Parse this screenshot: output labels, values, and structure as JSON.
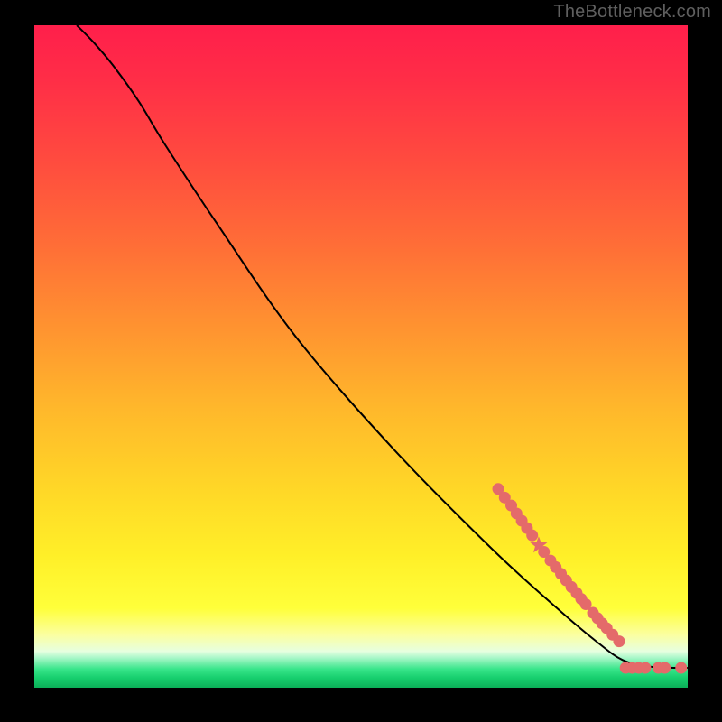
{
  "watermark": "TheBottleneck.com",
  "chart_data": {
    "type": "line",
    "title": "",
    "xlabel": "",
    "ylabel": "",
    "xlim": [
      0,
      100
    ],
    "ylim": [
      0,
      100
    ],
    "grid": false,
    "curve": [
      {
        "x": 6.5,
        "y": 100.0
      },
      {
        "x": 9.0,
        "y": 97.5
      },
      {
        "x": 12.0,
        "y": 94.0
      },
      {
        "x": 16.0,
        "y": 88.5
      },
      {
        "x": 20.0,
        "y": 82.0
      },
      {
        "x": 28.0,
        "y": 70.0
      },
      {
        "x": 40.0,
        "y": 53.0
      },
      {
        "x": 55.0,
        "y": 36.0
      },
      {
        "x": 70.0,
        "y": 21.0
      },
      {
        "x": 80.0,
        "y": 12.0
      },
      {
        "x": 86.0,
        "y": 7.0
      },
      {
        "x": 90.0,
        "y": 4.2
      },
      {
        "x": 94.0,
        "y": 3.2
      },
      {
        "x": 98.0,
        "y": 3.0
      },
      {
        "x": 100.0,
        "y": 3.0
      }
    ],
    "scatter": [
      {
        "x": 71.0,
        "y": 30.0
      },
      {
        "x": 72.0,
        "y": 28.7
      },
      {
        "x": 73.0,
        "y": 27.5
      },
      {
        "x": 73.8,
        "y": 26.3
      },
      {
        "x": 74.6,
        "y": 25.2
      },
      {
        "x": 75.4,
        "y": 24.1
      },
      {
        "x": 76.2,
        "y": 23.0
      },
      {
        "x": 78.0,
        "y": 20.5
      },
      {
        "x": 79.0,
        "y": 19.2
      },
      {
        "x": 79.8,
        "y": 18.2
      },
      {
        "x": 80.6,
        "y": 17.2
      },
      {
        "x": 81.4,
        "y": 16.2
      },
      {
        "x": 82.2,
        "y": 15.2
      },
      {
        "x": 83.0,
        "y": 14.3
      },
      {
        "x": 83.7,
        "y": 13.4
      },
      {
        "x": 84.4,
        "y": 12.6
      },
      {
        "x": 85.5,
        "y": 11.3
      },
      {
        "x": 86.2,
        "y": 10.5
      },
      {
        "x": 86.9,
        "y": 9.7
      },
      {
        "x": 87.6,
        "y": 9.0
      },
      {
        "x": 88.5,
        "y": 8.0
      },
      {
        "x": 89.5,
        "y": 7.0
      },
      {
        "x": 90.5,
        "y": 3.0
      },
      {
        "x": 91.5,
        "y": 3.0
      },
      {
        "x": 92.5,
        "y": 3.0
      },
      {
        "x": 93.5,
        "y": 3.0
      },
      {
        "x": 95.5,
        "y": 3.0
      },
      {
        "x": 96.5,
        "y": 3.0
      },
      {
        "x": 99.0,
        "y": 3.0
      }
    ],
    "star": {
      "x": 77.2,
      "y": 21.5
    },
    "gradient_stops": [
      {
        "offset": 0.0,
        "color": "#ff1f4b"
      },
      {
        "offset": 0.08,
        "color": "#ff2d47"
      },
      {
        "offset": 0.2,
        "color": "#ff4a3f"
      },
      {
        "offset": 0.33,
        "color": "#ff6d37"
      },
      {
        "offset": 0.46,
        "color": "#ff9430"
      },
      {
        "offset": 0.58,
        "color": "#ffb82b"
      },
      {
        "offset": 0.7,
        "color": "#ffd727"
      },
      {
        "offset": 0.8,
        "color": "#ffef28"
      },
      {
        "offset": 0.88,
        "color": "#ffff3a"
      },
      {
        "offset": 0.92,
        "color": "#fbffa0"
      },
      {
        "offset": 0.945,
        "color": "#e7ffe0"
      },
      {
        "offset": 0.955,
        "color": "#a8f7c8"
      },
      {
        "offset": 0.972,
        "color": "#38e58a"
      },
      {
        "offset": 0.985,
        "color": "#17cf6e"
      },
      {
        "offset": 1.0,
        "color": "#0cae58"
      }
    ],
    "marker_color": "#e46a6a",
    "curve_color": "#000000"
  }
}
